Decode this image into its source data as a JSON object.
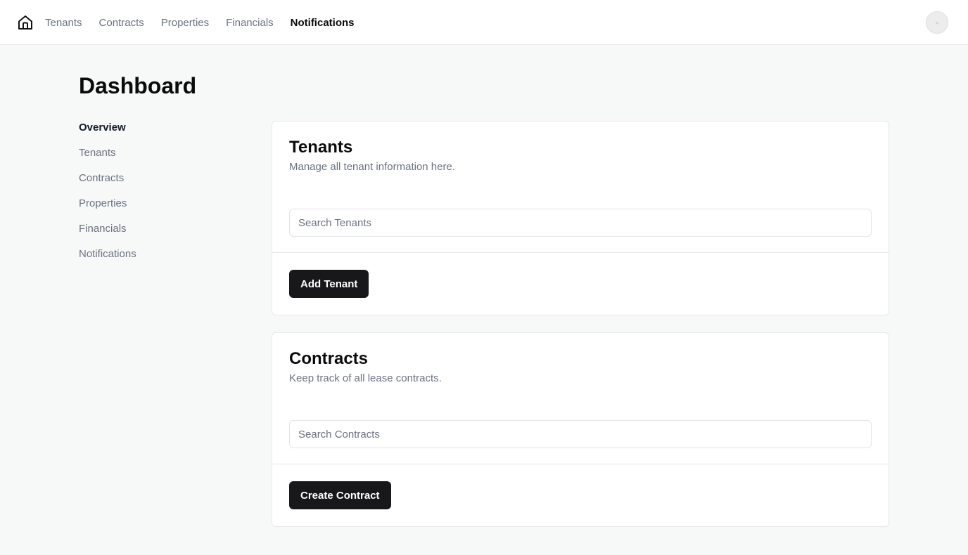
{
  "topbar": {
    "home_icon": "home-icon",
    "nav": [
      {
        "label": "Tenants",
        "active": false
      },
      {
        "label": "Contracts",
        "active": false
      },
      {
        "label": "Properties",
        "active": false
      },
      {
        "label": "Financials",
        "active": false
      },
      {
        "label": "Notifications",
        "active": true
      }
    ],
    "avatar_icon": "avatar"
  },
  "page": {
    "title": "Dashboard"
  },
  "sidebar": {
    "items": [
      {
        "label": "Overview",
        "active": true
      },
      {
        "label": "Tenants",
        "active": false
      },
      {
        "label": "Contracts",
        "active": false
      },
      {
        "label": "Properties",
        "active": false
      },
      {
        "label": "Financials",
        "active": false
      },
      {
        "label": "Notifications",
        "active": false
      }
    ]
  },
  "cards": {
    "tenants": {
      "title": "Tenants",
      "description": "Manage all tenant information here.",
      "search_placeholder": "Search Tenants",
      "search_value": "",
      "button_label": "Add Tenant"
    },
    "contracts": {
      "title": "Contracts",
      "description": "Keep track of all lease contracts.",
      "search_placeholder": "Search Contracts",
      "search_value": "",
      "button_label": "Create Contract"
    }
  },
  "colors": {
    "background": "#f7f8f8",
    "surface": "#ffffff",
    "border": "#e5e7eb",
    "text_primary": "#0b0b0b",
    "text_muted": "#6b7280",
    "button_bg": "#18181b",
    "button_text": "#ffffff"
  }
}
